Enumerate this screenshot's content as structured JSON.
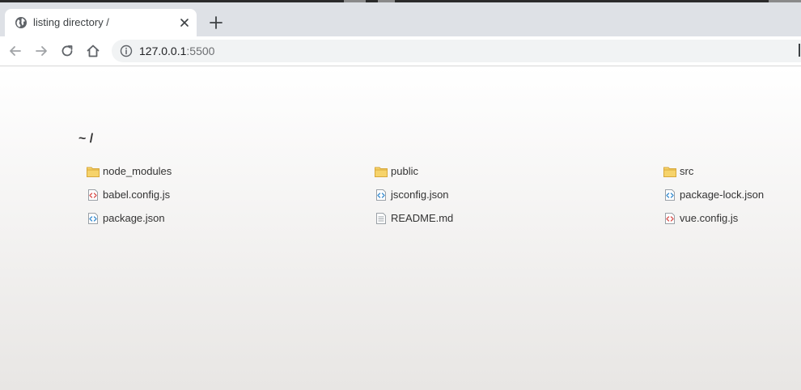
{
  "browser": {
    "tab": {
      "title": "listing directory /"
    },
    "address": {
      "host": "127.0.0.1",
      "port": ":5500"
    }
  },
  "listing": {
    "title": "~ /",
    "files": [
      {
        "name": "node_modules",
        "icon": "folder-icon"
      },
      {
        "name": "public",
        "icon": "folder-icon"
      },
      {
        "name": "src",
        "icon": "folder-icon"
      },
      {
        "name": "babel.config.js",
        "icon": "js-file-icon"
      },
      {
        "name": "jsconfig.json",
        "icon": "json-file-icon"
      },
      {
        "name": "package-lock.json",
        "icon": "json-file-icon"
      },
      {
        "name": "package.json",
        "icon": "json-file-icon"
      },
      {
        "name": "README.md",
        "icon": "text-file-icon"
      },
      {
        "name": "vue.config.js",
        "icon": "js-file-icon"
      }
    ]
  },
  "colors": {
    "tab_strip": "#dee1e6",
    "omnibox": "#f1f3f4",
    "folder": "#f6d36b",
    "js_icon": "#d9534f",
    "json_icon": "#3b8ed0"
  }
}
